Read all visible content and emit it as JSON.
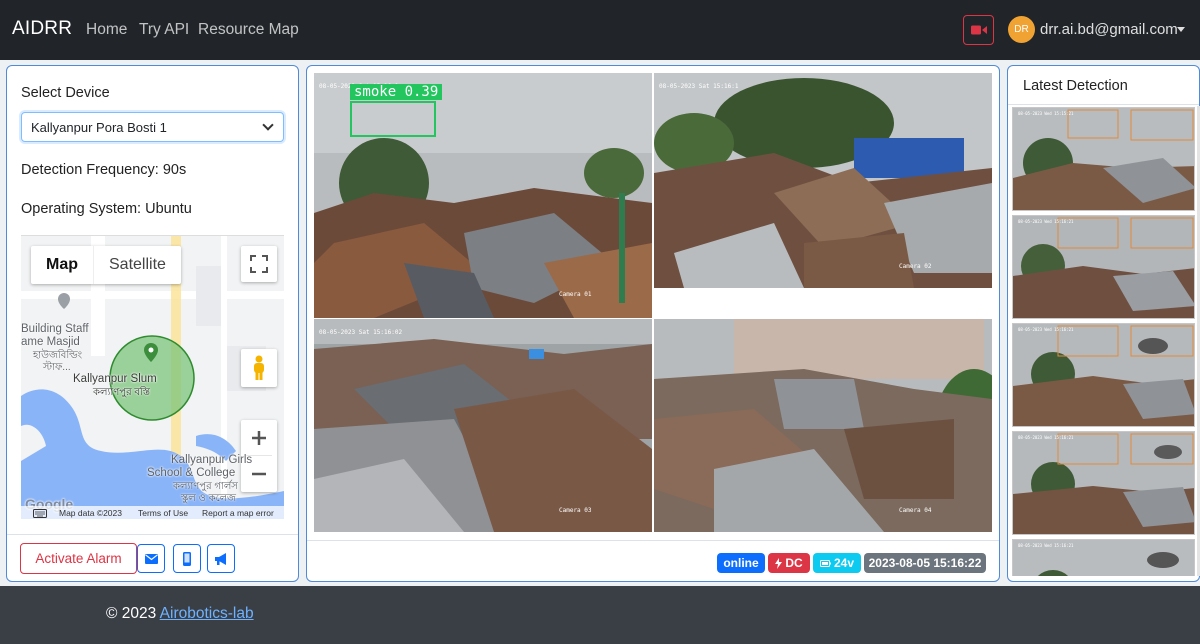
{
  "navbar": {
    "brand": "AIDRR",
    "links": [
      "Home",
      "Try API",
      "Resource Map"
    ],
    "avatar_initials": "DR",
    "user_email": "drr.ai.bd@gmail.com"
  },
  "left_panel": {
    "select_device_label": "Select Device",
    "device_selected": "Kallyanpur Pora Bosti 1",
    "detection_frequency": "Detection Frequency: 90s",
    "operating_system": "Operating System: Ubuntu",
    "map": {
      "tabs": [
        "Map",
        "Satellite"
      ],
      "labels": {
        "building": "Building Staff",
        "masjid": "ame Masjid",
        "masjid_bn": "হাউজবিল্ডিং",
        "masjid_bn2": "স্টাফ...",
        "slum": "Kallyanpur Slum",
        "slum_bn": "কল্যাণপুর বস্তি",
        "school1": "Kallyanpur Girls",
        "school2": "School & College",
        "school_bn1": "কল্যাণপুর গার্লস",
        "school_bn2": "স্কুল ও কলেজ"
      },
      "logo": "Google",
      "footer": {
        "data": "Map data ©2023",
        "terms": "Terms of Use",
        "report": "Report a map error"
      }
    },
    "alarm_button": "Activate Alarm"
  },
  "cameras": [
    {
      "timestamp": "08-05-2023 Sat 15:16:1",
      "name": "Camera 01",
      "detection": {
        "label": "smoke 0.39"
      }
    },
    {
      "timestamp": "08-05-2023 Sat 15:16:1",
      "name": "Camera 02"
    },
    {
      "timestamp": "08-05-2023 Sat 15:16:02",
      "name": "Camera 03"
    },
    {
      "timestamp": "",
      "name": "Camera 04"
    }
  ],
  "status": {
    "online": "online",
    "power": "DC",
    "voltage": "24v",
    "datetime": "2023-08-05 15:16:22",
    "colors": {
      "online": "#0d6efd",
      "power": "#dc3545",
      "voltage": "#0dcaf0",
      "datetime": "#6c757d"
    }
  },
  "right_panel": {
    "title": "Latest Detection",
    "thumbs": [
      {
        "timestamp": "08-05-2023 Wed 15:15:21"
      },
      {
        "timestamp": "08-05-2023 Wed 15:16:21"
      },
      {
        "timestamp": "08-05-2023 Wed 15:16:21"
      },
      {
        "timestamp": "08-05-2023 Wed 15:16:21"
      },
      {
        "timestamp": "08-05-2023 Wed 15:16:21"
      }
    ]
  },
  "footer": {
    "copyright": "© 2023",
    "link": "Airobotics-lab"
  }
}
